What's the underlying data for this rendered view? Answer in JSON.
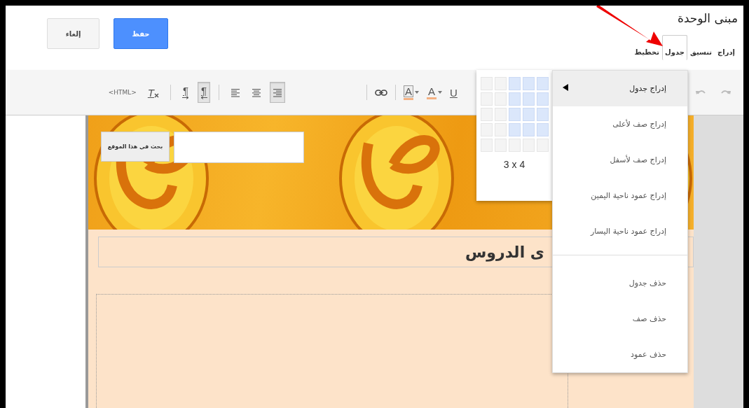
{
  "header": {
    "title": "مبنى الوحدة",
    "buttons": [
      {
        "label": "حفظ",
        "kind": "primary"
      },
      {
        "label": "إلغاء",
        "kind": "secondary"
      }
    ]
  },
  "tabs": [
    {
      "label": "إدراج",
      "selected": false
    },
    {
      "label": "تنسيق",
      "selected": false
    },
    {
      "label": "جدول",
      "selected": true
    },
    {
      "label": "تخطيط",
      "selected": false
    }
  ],
  "toolbar": {
    "groups": [
      [
        {
          "kind": "redo"
        },
        {
          "kind": "undo"
        },
        {
          "kind": "separator"
        }
      ],
      [
        {
          "kind": "underline",
          "label": "U"
        },
        {
          "kind": "text-color",
          "label": "A"
        },
        {
          "kind": "highlight",
          "label": "A"
        },
        {
          "kind": "separator"
        },
        {
          "kind": "link"
        },
        {
          "kind": "separator"
        }
      ],
      [
        {
          "kind": "align-right",
          "pressed": true
        },
        {
          "kind": "align-center",
          "pressed": false
        },
        {
          "kind": "align-left",
          "pressed": false
        },
        {
          "kind": "separator"
        },
        {
          "kind": "rtl",
          "label": "¶",
          "pressed": true
        },
        {
          "kind": "ltr",
          "label": "¶",
          "pressed": false
        },
        {
          "kind": "separator"
        },
        {
          "kind": "clear-format",
          "label": "T"
        },
        {
          "kind": "html",
          "label": "<HTML>"
        }
      ]
    ]
  },
  "page": {
    "search_button": "بحث في هذا الموقع",
    "heading": "ى الدروس"
  },
  "table_picker": {
    "rows": [
      {
        "cells": [
          {
            "selected": false
          },
          {
            "selected": false
          },
          {
            "selected": true
          },
          {
            "selected": true
          },
          {
            "selected": true
          }
        ]
      },
      {
        "cells": [
          {
            "selected": false
          },
          {
            "selected": false
          },
          {
            "selected": true
          },
          {
            "selected": true
          },
          {
            "selected": true
          }
        ]
      },
      {
        "cells": [
          {
            "selected": false
          },
          {
            "selected": false
          },
          {
            "selected": true
          },
          {
            "selected": true
          },
          {
            "selected": true
          }
        ]
      },
      {
        "cells": [
          {
            "selected": false
          },
          {
            "selected": false
          },
          {
            "selected": true
          },
          {
            "selected": true
          },
          {
            "selected": true
          }
        ]
      },
      {
        "cells": [
          {
            "selected": false
          },
          {
            "selected": false
          },
          {
            "selected": false
          },
          {
            "selected": false
          },
          {
            "selected": false
          }
        ]
      }
    ],
    "size_label": "3 x 4"
  },
  "table_menu": {
    "groups": [
      [
        {
          "label": "إدراج جدول",
          "selected": true,
          "has_submenu": true
        },
        {
          "label": "إدراج صف لأعلى",
          "selected": false,
          "has_submenu": false
        },
        {
          "label": "إدراج صف لأسفل",
          "selected": false,
          "has_submenu": false
        },
        {
          "label": "إدراج عمود ناحية اليمين",
          "selected": false,
          "has_submenu": false
        },
        {
          "label": "إدراج عمود ناحية اليسار",
          "selected": false,
          "has_submenu": false
        }
      ],
      [
        {
          "label": "حذف جدول",
          "selected": false,
          "has_submenu": false
        },
        {
          "label": "حذف صف",
          "selected": false,
          "has_submenu": false
        },
        {
          "label": "حذف عمود",
          "selected": false,
          "has_submenu": false
        }
      ]
    ]
  }
}
